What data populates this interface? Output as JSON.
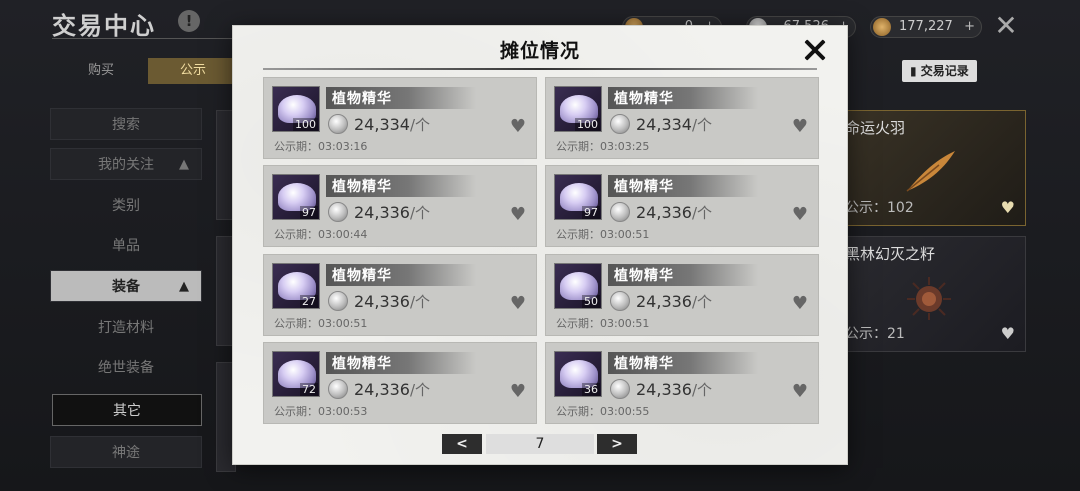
{
  "background": {
    "title": "交易中心",
    "info_icon": "!",
    "currencies": [
      {
        "value": "0",
        "plus": "+"
      },
      {
        "value": "67,526",
        "plus": "+"
      },
      {
        "value": "177,227",
        "plus": "+"
      }
    ],
    "close_icon": "✕",
    "tabs": [
      "购买",
      "公示"
    ],
    "trade_record": "交易记录",
    "sidebar": [
      {
        "label": "搜索"
      },
      {
        "label": "我的关注",
        "arrow": "▲"
      },
      {
        "label": "类别"
      },
      {
        "label": "单品"
      },
      {
        "label": "装备",
        "arrow": "▲"
      },
      {
        "label": "打造材料"
      },
      {
        "label": "绝世装备"
      },
      {
        "label": "其它"
      },
      {
        "label": "神途"
      }
    ],
    "cards": [
      {
        "name": "命运火羽",
        "pub": "公示：102",
        "heart": "♥"
      },
      {
        "name": "黑林幻灭之籽",
        "pub": "公示：21",
        "heart": "♥"
      }
    ]
  },
  "modal": {
    "title": "摊位情况",
    "listings": [
      {
        "name": "植物精华",
        "qty": "100",
        "price": "24,334",
        "unit": "/个",
        "pub": "公示期：03:03:16"
      },
      {
        "name": "植物精华",
        "qty": "100",
        "price": "24,334",
        "unit": "/个",
        "pub": "公示期：03:03:25"
      },
      {
        "name": "植物精华",
        "qty": "97",
        "price": "24,336",
        "unit": "/个",
        "pub": "公示期：03:00:44"
      },
      {
        "name": "植物精华",
        "qty": "97",
        "price": "24,336",
        "unit": "/个",
        "pub": "公示期：03:00:51"
      },
      {
        "name": "植物精华",
        "qty": "27",
        "price": "24,336",
        "unit": "/个",
        "pub": "公示期：03:00:51"
      },
      {
        "name": "植物精华",
        "qty": "50",
        "price": "24,336",
        "unit": "/个",
        "pub": "公示期：03:00:51"
      },
      {
        "name": "植物精华",
        "qty": "72",
        "price": "24,336",
        "unit": "/个",
        "pub": "公示期：03:00:53"
      },
      {
        "name": "植物精华",
        "qty": "36",
        "price": "24,336",
        "unit": "/个",
        "pub": "公示期：03:00:55"
      }
    ],
    "pager": {
      "prev": "<",
      "page": "7",
      "next": ">"
    }
  },
  "colors": {
    "modal_bg": "#f2f2ef",
    "listing_bg": "#c9c9c6",
    "accent_gold": "#6b5a32"
  }
}
